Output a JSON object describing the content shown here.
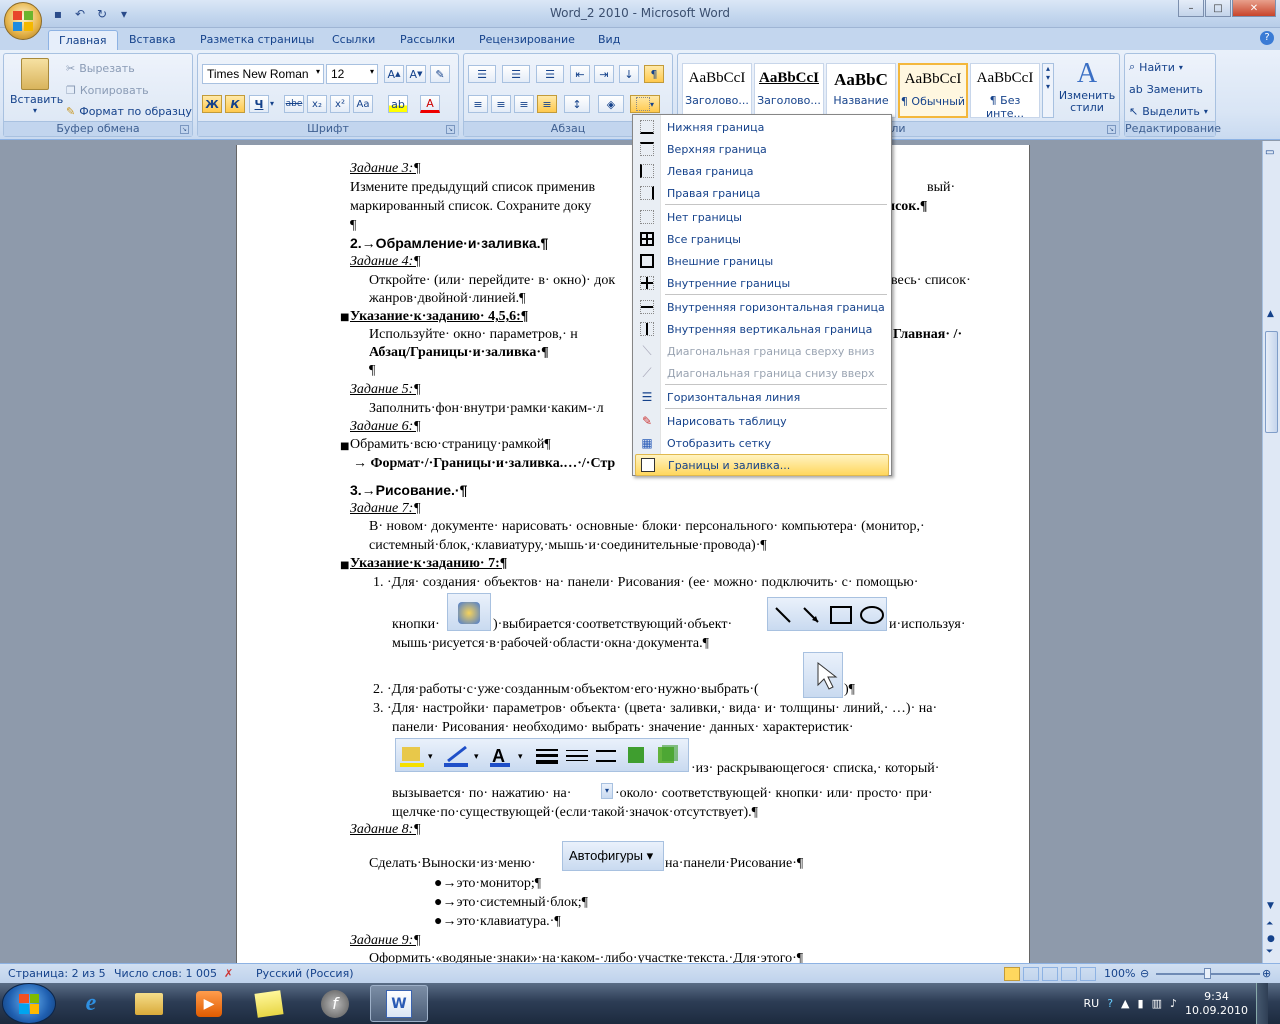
{
  "window": {
    "title": "Word_2 2010 - Microsoft Word",
    "controls": {
      "minimize": "–",
      "maximize": "□",
      "close": "✕"
    }
  },
  "ribbon_tabs": [
    "Главная",
    "Вставка",
    "Разметка страницы",
    "Ссылки",
    "Рассылки",
    "Рецензирование",
    "Вид"
  ],
  "clipboard": {
    "paste": "Вставить",
    "cut": "Вырезать",
    "copy": "Копировать",
    "format_painter": "Формат по образцу",
    "label": "Буфер обмена"
  },
  "font": {
    "name": "Times New Roman",
    "size": "12",
    "label": "Шрифт",
    "bold": "Ж",
    "italic": "К",
    "underline": "Ч",
    "strike": "abe",
    "sub": "x₂",
    "sup": "x²",
    "case": "Aa"
  },
  "paragraph": {
    "label": "Абзац"
  },
  "styles": {
    "items": [
      {
        "sample": "AaBbCcI",
        "name": "Заголово..."
      },
      {
        "sample": "AaBbCcI",
        "name": "Заголово..."
      },
      {
        "sample": "AaBbC",
        "name": "Название"
      },
      {
        "sample": "AaBbCcI",
        "name": "¶ Обычный"
      },
      {
        "sample": "AaBbCcI",
        "name": "¶ Без инте..."
      }
    ],
    "change_styles": "Изменить стили",
    "label": "ли"
  },
  "editing": {
    "find": "Найти",
    "replace": "Заменить",
    "select": "Выделить",
    "label": "Редактирование"
  },
  "border_menu": {
    "items": [
      {
        "label": "Нижняя граница",
        "icon": "bottom-border-icon",
        "disabled": false
      },
      {
        "label": "Верхняя граница",
        "icon": "top-border-icon",
        "disabled": false
      },
      {
        "label": "Левая граница",
        "icon": "left-border-icon",
        "disabled": false
      },
      {
        "label": "Правая граница",
        "icon": "right-border-icon",
        "disabled": false
      },
      {
        "label": "Нет границы",
        "icon": "no-border-icon",
        "disabled": false
      },
      {
        "label": "Все границы",
        "icon": "all-borders-icon",
        "disabled": false
      },
      {
        "label": "Внешние границы",
        "icon": "outside-borders-icon",
        "disabled": false
      },
      {
        "label": "Внутренние границы",
        "icon": "inside-borders-icon",
        "disabled": false
      },
      {
        "label": "Внутренняя горизонтальная граница",
        "icon": "inside-horizontal-border-icon",
        "disabled": false
      },
      {
        "label": "Внутренняя вертикальная граница",
        "icon": "inside-vertical-border-icon",
        "disabled": false
      },
      {
        "label": "Диагональная граница сверху вниз",
        "icon": "diagonal-down-border-icon",
        "disabled": true
      },
      {
        "label": "Диагональная граница снизу вверх",
        "icon": "diagonal-up-border-icon",
        "disabled": true
      },
      {
        "label": "Горизонтальная линия",
        "icon": "horizontal-line-icon",
        "disabled": false
      },
      {
        "label": "Нарисовать таблицу",
        "icon": "draw-table-icon",
        "disabled": false
      },
      {
        "label": "Отобразить сетку",
        "icon": "view-gridlines-icon",
        "disabled": false
      },
      {
        "label": "Границы и заливка...",
        "icon": "borders-shading-icon",
        "disabled": false,
        "highlighted": true
      }
    ]
  },
  "document": {
    "lines": [
      {
        "text": "Задание 3:¶",
        "style": "it"
      },
      {
        "text": "Измените предыдущий список применив",
        "style": "n"
      },
      {
        "text": "вый·",
        "style": "n"
      },
      {
        "text": "маркированный список. Сохраните доку",
        "style": "n"
      },
      {
        "text": "исок.¶",
        "style": "b"
      },
      {
        "text": "¶",
        "style": "n"
      },
      {
        "text": "2.→Обрамление·и·заливка.¶",
        "style": "h"
      },
      {
        "text": "Задание 4:¶",
        "style": "it"
      },
      {
        "text": "Откройте· (или· перейдите· в· окно)· док",
        "style": "n"
      },
      {
        "text": "весь· список·",
        "style": "n"
      },
      {
        "text": "жанров·двойной·линией.¶",
        "style": "n"
      },
      {
        "text": "Указание·к·заданию· 4,5,6:¶",
        "style": "bu"
      },
      {
        "text": "Используйте· окно· параметров,· н",
        "style": "n"
      },
      {
        "text": "Главная· /·",
        "style": "b"
      },
      {
        "text": "Абзац/Границы·и·заливка·¶",
        "style": "b"
      },
      {
        "text": "¶",
        "style": "n"
      },
      {
        "text": "Задание 5:¶",
        "style": "it"
      },
      {
        "text": "Заполнить·фон·внутри·рамки·каким-·л",
        "style": "n"
      },
      {
        "text": "Задание 6:¶",
        "style": "it"
      },
      {
        "text": "Обрамить·всю·страницу·рамкой¶",
        "style": "n"
      },
      {
        "text": "→ Формат·/·Границы·и·заливка.…·/·Стр",
        "style": "b"
      },
      {
        "text": "3.→Рисование.·¶",
        "style": "h"
      },
      {
        "text": "Задание 7:¶",
        "style": "it"
      },
      {
        "text": "В· новом· документе· нарисовать· основные· блоки· персонального· компьютера· (монитор,·",
        "style": "n"
      },
      {
        "text": "системный·блок,·клавиатуру,·мышь·и·соединительные·провода)·¶",
        "style": "n"
      },
      {
        "text": "Указание·к·заданию· 7:¶",
        "style": "bu"
      },
      {
        "text": "1. ·Для· создания· объектов· на· панели· Рисования· (ее· можно· подключить· с· помощью·",
        "style": "n"
      },
      {
        "text": "кнопки·",
        "style": "n"
      },
      {
        "text": ")·выбирается·соответствующий·объект·",
        "style": "n"
      },
      {
        "text": "и·используя·",
        "style": "n"
      },
      {
        "text": "мышь·рисуется·в·рабочей·области·окна·документа.¶",
        "style": "n"
      },
      {
        "text": "2. ·Для·работы·с·уже·созданным·объектом·его·нужно·выбрать·(",
        "style": "n"
      },
      {
        "text": ")¶",
        "style": "n"
      },
      {
        "text": "3. ·Для· настройки· параметров· объекта· (цвета· заливки,· вида· и· толщины· линий,· …)· на·",
        "style": "n"
      },
      {
        "text": "панели· Рисования· необходимо· выбрать· значение· данных· характеристик·",
        "style": "n"
      },
      {
        "text": "·из· раскрывающегося· списка,· который·",
        "style": "n"
      },
      {
        "text": "вызывается· по· нажатию· на·",
        "style": "n"
      },
      {
        "text": "·около· соответствующей· кнопки· или· просто· при·",
        "style": "n"
      },
      {
        "text": "щелчке·по·существующей·(если·такой·значок·отсутствует).¶",
        "style": "n"
      },
      {
        "text": "Задание 8:¶",
        "style": "it"
      },
      {
        "text": "Сделать·Выноски·из·меню·",
        "style": "n"
      },
      {
        "text": "Автофигуры",
        "style": "btn"
      },
      {
        "text": "на·панели·Рисование·¶",
        "style": "n"
      },
      {
        "text": "●→это·монитор;¶",
        "style": "n"
      },
      {
        "text": "●→это·системный·блок;¶",
        "style": "n"
      },
      {
        "text": "●→это·клавиатура.·¶",
        "style": "n"
      },
      {
        "text": "Задание 9:¶",
        "style": "it"
      },
      {
        "text": "Оформить·«водяные·знаки»·на·каком-·либо·участке·текста.·Для·этого·¶",
        "style": "n"
      }
    ]
  },
  "status": {
    "page": "Страница: 2 из 5",
    "words": "Число слов: 1 005",
    "language": "Русский (Россия)",
    "zoom": "100%",
    "zoom_fraction": 0.5
  },
  "taskbar": {
    "lang": "RU",
    "time": "9:34",
    "date": "10.09.2010"
  },
  "colors": {
    "accent": "#15428b",
    "menu_highlight": "#ffd75e",
    "office_orange": "#e8b850"
  }
}
